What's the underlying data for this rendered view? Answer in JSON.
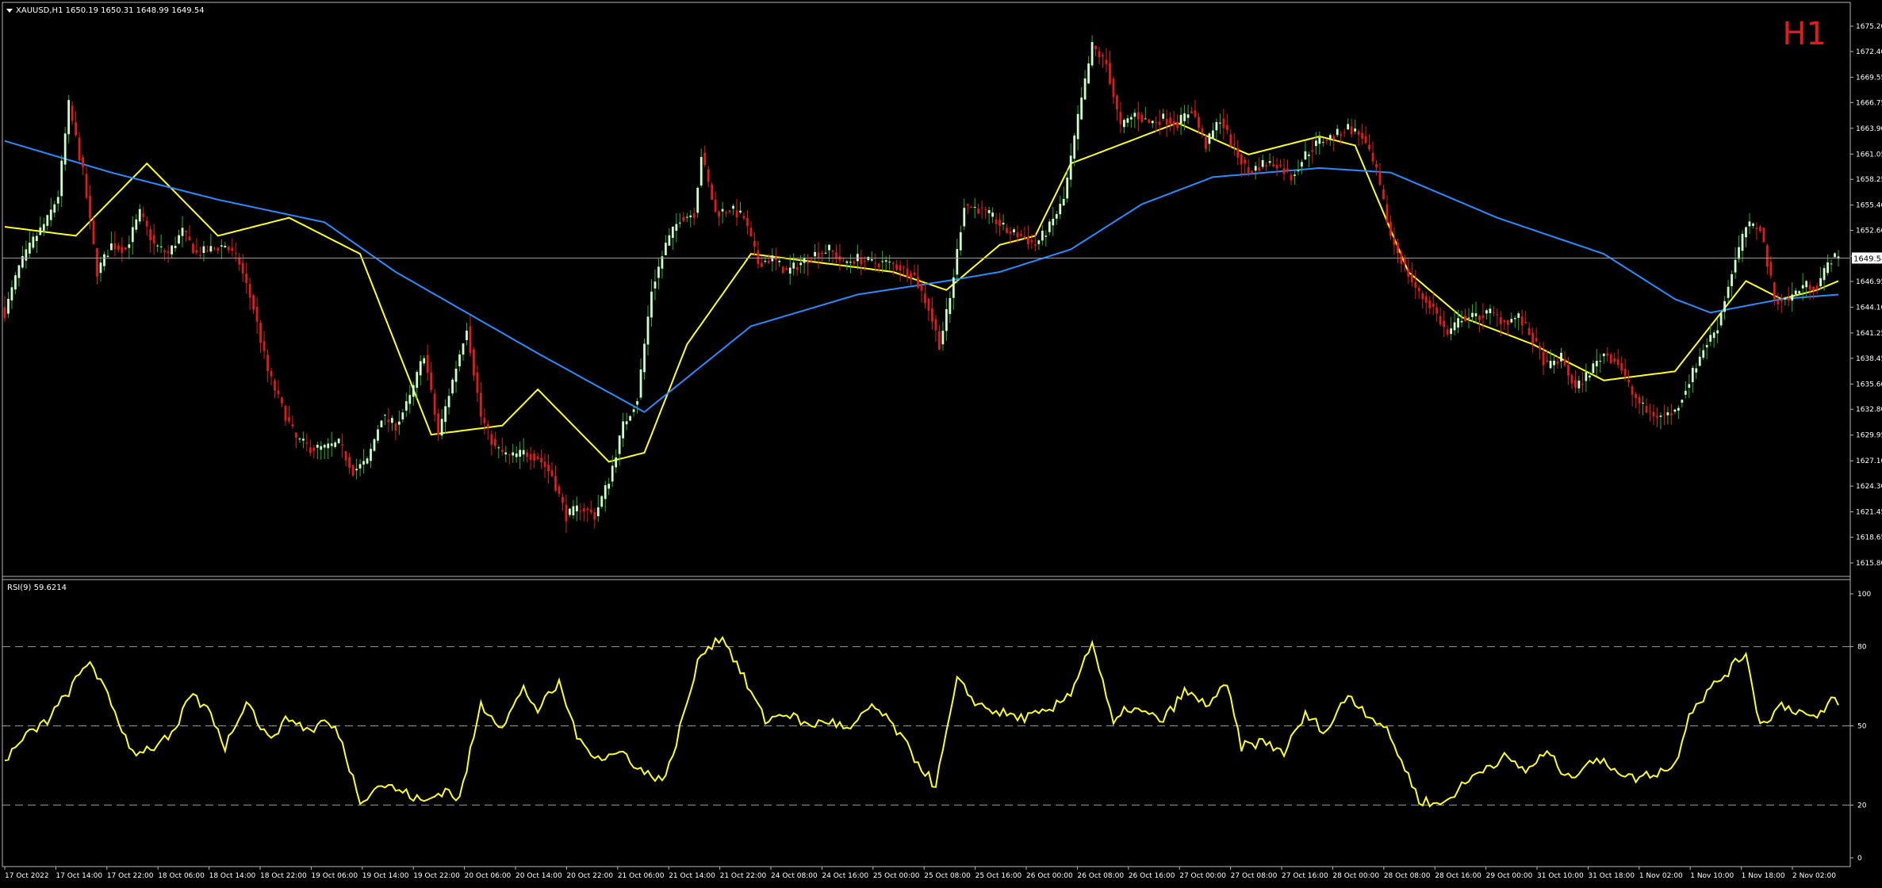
{
  "header": {
    "symbol_line": "XAUUSD,H1  1650.19 1650.31 1648.99 1649.54",
    "timeframe_badge": "H1"
  },
  "rsi_header": "RSI(9) 59.6214",
  "current_price_label": "1649.54",
  "colors": {
    "background": "#000000",
    "bull": "#ccffcc",
    "bear": "#e11b1b",
    "wick_bull": "#22b822",
    "wick_bear": "#e11b1b",
    "ma_fast": "#ffff22",
    "ma_slow": "#2a8cff",
    "axis_text": "#ffffff",
    "timeframe": "#e11b1b"
  },
  "chart_data": [
    {
      "type": "candlestick",
      "symbol": "XAUUSD",
      "timeframe": "H1",
      "ylim": [
        1615.8,
        1675.2
      ],
      "y_ticks": [
        "1675.20",
        "1672.40",
        "1669.55",
        "1666.75",
        "1663.90",
        "1661.05",
        "1658.25",
        "1655.40",
        "1652.60",
        "1649.75",
        "1646.95",
        "1644.10",
        "1641.25",
        "1638.45",
        "1635.60",
        "1632.80",
        "1629.95",
        "1627.10",
        "1624.30",
        "1621.45",
        "1618.65",
        "1615.80"
      ],
      "x_ticks": [
        "17 Oct 2022",
        "17 Oct 14:00",
        "17 Oct 22:00",
        "18 Oct 06:00",
        "18 Oct 14:00",
        "18 Oct 22:00",
        "19 Oct 06:00",
        "19 Oct 14:00",
        "19 Oct 22:00",
        "20 Oct 06:00",
        "20 Oct 14:00",
        "20 Oct 22:00",
        "21 Oct 06:00",
        "21 Oct 14:00",
        "21 Oct 22:00",
        "24 Oct 08:00",
        "24 Oct 16:00",
        "25 Oct 00:00",
        "25 Oct 08:00",
        "25 Oct 16:00",
        "26 Oct 00:00",
        "26 Oct 08:00",
        "26 Oct 16:00",
        "27 Oct 00:00",
        "27 Oct 08:00",
        "27 Oct 16:00",
        "28 Oct 00:00",
        "28 Oct 08:00",
        "28 Oct 16:00",
        "29 Oct 00:00",
        "31 Oct 10:00",
        "31 Oct 18:00",
        "1 Nov 02:00",
        "1 Nov 10:00",
        "1 Nov 18:00",
        "2 Nov 02:00"
      ],
      "current_price": 1649.54,
      "close_anchors": [
        [
          0,
          1643.5
        ],
        [
          4,
          1648.5
        ],
        [
          8,
          1651.5
        ],
        [
          12,
          1653.8
        ],
        [
          15,
          1656.5
        ],
        [
          18,
          1666.5
        ],
        [
          22,
          1659
        ],
        [
          26,
          1648
        ],
        [
          30,
          1651
        ],
        [
          34,
          1650.5
        ],
        [
          38,
          1654.5
        ],
        [
          42,
          1651
        ],
        [
          46,
          1650
        ],
        [
          50,
          1652.5
        ],
        [
          54,
          1650
        ],
        [
          58,
          1650.5
        ],
        [
          62,
          1651
        ],
        [
          66,
          1649
        ],
        [
          70,
          1644
        ],
        [
          74,
          1637
        ],
        [
          78,
          1633
        ],
        [
          82,
          1629.5
        ],
        [
          86,
          1628.5
        ],
        [
          90,
          1628.5
        ],
        [
          94,
          1629
        ],
        [
          98,
          1626
        ],
        [
          102,
          1627
        ],
        [
          106,
          1632
        ],
        [
          110,
          1631
        ],
        [
          114,
          1634
        ],
        [
          118,
          1639
        ],
        [
          122,
          1630
        ],
        [
          126,
          1636
        ],
        [
          130,
          1642
        ],
        [
          134,
          1632
        ],
        [
          138,
          1628.5
        ],
        [
          142,
          1627.5
        ],
        [
          146,
          1628
        ],
        [
          150,
          1627.5
        ],
        [
          154,
          1625.5
        ],
        [
          158,
          1621
        ],
        [
          162,
          1622
        ],
        [
          166,
          1621
        ],
        [
          170,
          1625
        ],
        [
          174,
          1631
        ],
        [
          178,
          1634
        ],
        [
          182,
          1646
        ],
        [
          186,
          1651
        ],
        [
          190,
          1654
        ],
        [
          194,
          1654.5
        ],
        [
          196,
          1661
        ],
        [
          200,
          1654.5
        ],
        [
          204,
          1655
        ],
        [
          208,
          1654
        ],
        [
          212,
          1649
        ],
        [
          216,
          1649.5
        ],
        [
          220,
          1648
        ],
        [
          224,
          1649
        ],
        [
          228,
          1650
        ],
        [
          232,
          1650.5
        ],
        [
          236,
          1649
        ],
        [
          240,
          1649.5
        ],
        [
          244,
          1649
        ],
        [
          248,
          1649
        ],
        [
          252,
          1648.5
        ],
        [
          256,
          1647.5
        ],
        [
          260,
          1644
        ],
        [
          263,
          1640
        ],
        [
          266,
          1645
        ],
        [
          270,
          1655.5
        ],
        [
          274,
          1655
        ],
        [
          278,
          1654
        ],
        [
          282,
          1652.5
        ],
        [
          286,
          1652
        ],
        [
          290,
          1651
        ],
        [
          294,
          1653
        ],
        [
          298,
          1656
        ],
        [
          302,
          1665
        ],
        [
          306,
          1673
        ],
        [
          310,
          1671
        ],
        [
          314,
          1664
        ],
        [
          318,
          1665.5
        ],
        [
          322,
          1664.5
        ],
        [
          326,
          1665
        ],
        [
          330,
          1664.5
        ],
        [
          334,
          1666
        ],
        [
          338,
          1662
        ],
        [
          342,
          1665
        ],
        [
          346,
          1661.5
        ],
        [
          350,
          1659
        ],
        [
          354,
          1660
        ],
        [
          358,
          1660
        ],
        [
          362,
          1658.5
        ],
        [
          366,
          1661
        ],
        [
          370,
          1662.5
        ],
        [
          374,
          1663
        ],
        [
          378,
          1664
        ],
        [
          382,
          1663
        ],
        [
          386,
          1659
        ],
        [
          390,
          1652
        ],
        [
          394,
          1648.5
        ],
        [
          398,
          1645.5
        ],
        [
          402,
          1644
        ],
        [
          406,
          1641
        ],
        [
          410,
          1643
        ],
        [
          414,
          1643
        ],
        [
          418,
          1643.5
        ],
        [
          422,
          1642.5
        ],
        [
          426,
          1643
        ],
        [
          430,
          1640.5
        ],
        [
          434,
          1637.5
        ],
        [
          438,
          1638.5
        ],
        [
          442,
          1635
        ],
        [
          446,
          1637
        ],
        [
          450,
          1639
        ],
        [
          454,
          1638
        ],
        [
          458,
          1634.5
        ],
        [
          462,
          1632.5
        ],
        [
          466,
          1632
        ],
        [
          470,
          1632.5
        ],
        [
          474,
          1636
        ],
        [
          478,
          1639.5
        ],
        [
          482,
          1642
        ],
        [
          486,
          1648
        ],
        [
          490,
          1653
        ],
        [
          494,
          1653
        ],
        [
          498,
          1645
        ],
        [
          502,
          1645
        ],
        [
          506,
          1646.5
        ],
        [
          510,
          1646.5
        ],
        [
          514,
          1649.5
        ]
      ],
      "series": [
        {
          "name": "",
          "kind": "moving_average_fast",
          "color": "#ffff22",
          "anchors": [
            [
              0,
              1653
            ],
            [
              20,
              1652
            ],
            [
              40,
              1660
            ],
            [
              60,
              1652
            ],
            [
              80,
              1654
            ],
            [
              100,
              1650
            ],
            [
              120,
              1630
            ],
            [
              140,
              1631
            ],
            [
              150,
              1635
            ],
            [
              170,
              1627
            ],
            [
              180,
              1628
            ],
            [
              192,
              1640
            ],
            [
              210,
              1650
            ],
            [
              250,
              1648
            ],
            [
              265,
              1646
            ],
            [
              280,
              1651
            ],
            [
              290,
              1652
            ],
            [
              300,
              1660
            ],
            [
              330,
              1664.5
            ],
            [
              350,
              1661
            ],
            [
              370,
              1663
            ],
            [
              380,
              1662
            ],
            [
              395,
              1648
            ],
            [
              410,
              1643
            ],
            [
              430,
              1640
            ],
            [
              450,
              1636
            ],
            [
              470,
              1637
            ],
            [
              490,
              1647
            ],
            [
              500,
              1645
            ],
            [
              510,
              1646
            ],
            [
              516,
              1647
            ]
          ]
        },
        {
          "name": "",
          "kind": "moving_average_slow",
          "color": "#2a8cff",
          "anchors": [
            [
              0,
              1662.5
            ],
            [
              30,
              1659
            ],
            [
              60,
              1656
            ],
            [
              90,
              1653.5
            ],
            [
              110,
              1648
            ],
            [
              150,
              1639
            ],
            [
              180,
              1632.5
            ],
            [
              210,
              1642
            ],
            [
              240,
              1645.5
            ],
            [
              265,
              1647
            ],
            [
              280,
              1648
            ],
            [
              300,
              1650.5
            ],
            [
              320,
              1655.5
            ],
            [
              340,
              1658.5
            ],
            [
              370,
              1659.5
            ],
            [
              390,
              1659
            ],
            [
              420,
              1654
            ],
            [
              450,
              1650
            ],
            [
              470,
              1645
            ],
            [
              480,
              1643.5
            ],
            [
              500,
              1645
            ],
            [
              516,
              1645.5
            ]
          ]
        }
      ]
    },
    {
      "type": "line",
      "indicator": "RSI(9)",
      "ylim": [
        0,
        100
      ],
      "y_ticks": [
        100,
        80,
        50,
        20,
        0
      ],
      "reference_levels": [
        80,
        50,
        20
      ],
      "series": [
        {
          "name": "RSI(9)",
          "color": "#ffff22",
          "anchors": [
            [
              0,
              37
            ],
            [
              6,
              46
            ],
            [
              12,
              52
            ],
            [
              18,
              63
            ],
            [
              24,
              75
            ],
            [
              30,
              58
            ],
            [
              36,
              40
            ],
            [
              42,
              42
            ],
            [
              48,
              47
            ],
            [
              52,
              62
            ],
            [
              58,
              55
            ],
            [
              62,
              42
            ],
            [
              68,
              60
            ],
            [
              74,
              45
            ],
            [
              80,
              53
            ],
            [
              86,
              48
            ],
            [
              90,
              52
            ],
            [
              94,
              47
            ],
            [
              100,
              22
            ],
            [
              106,
              28
            ],
            [
              112,
              25
            ],
            [
              118,
              21
            ],
            [
              124,
              26
            ],
            [
              128,
              22
            ],
            [
              134,
              58
            ],
            [
              140,
              50
            ],
            [
              146,
              64
            ],
            [
              150,
              56
            ],
            [
              156,
              66
            ],
            [
              162,
              43
            ],
            [
              168,
              38
            ],
            [
              174,
              40
            ],
            [
              180,
              32
            ],
            [
              186,
              30
            ],
            [
              190,
              49
            ],
            [
              196,
              78
            ],
            [
              202,
              84
            ],
            [
              208,
              68
            ],
            [
              214,
              52
            ],
            [
              220,
              55
            ],
            [
              226,
              50
            ],
            [
              232,
              52
            ],
            [
              238,
              48
            ],
            [
              244,
              58
            ],
            [
              250,
              50
            ],
            [
              256,
              38
            ],
            [
              262,
              27
            ],
            [
              268,
              67
            ],
            [
              274,
              58
            ],
            [
              280,
              55
            ],
            [
              286,
              53
            ],
            [
              294,
              55
            ],
            [
              300,
              63
            ],
            [
              306,
              82
            ],
            [
              312,
              50
            ],
            [
              316,
              57
            ],
            [
              320,
              55
            ],
            [
              326,
              52
            ],
            [
              332,
              63
            ],
            [
              338,
              58
            ],
            [
              344,
              65
            ],
            [
              348,
              42
            ],
            [
              354,
              44
            ],
            [
              360,
              40
            ],
            [
              366,
              54
            ],
            [
              372,
              48
            ],
            [
              378,
              62
            ],
            [
              384,
              54
            ],
            [
              388,
              50
            ],
            [
              392,
              40
            ],
            [
              398,
              22
            ],
            [
              404,
              20
            ],
            [
              410,
              27
            ],
            [
              416,
              34
            ],
            [
              422,
              38
            ],
            [
              428,
              33
            ],
            [
              434,
              40
            ],
            [
              440,
              30
            ],
            [
              446,
              37
            ],
            [
              452,
              35
            ],
            [
              458,
              30
            ],
            [
              464,
              32
            ],
            [
              470,
              35
            ],
            [
              474,
              55
            ],
            [
              480,
              64
            ],
            [
              486,
              72
            ],
            [
              490,
              78
            ],
            [
              494,
              50
            ],
            [
              500,
              58
            ],
            [
              506,
              55
            ],
            [
              510,
              52
            ],
            [
              514,
              60
            ],
            [
              516,
              59.6
            ]
          ]
        }
      ]
    }
  ]
}
